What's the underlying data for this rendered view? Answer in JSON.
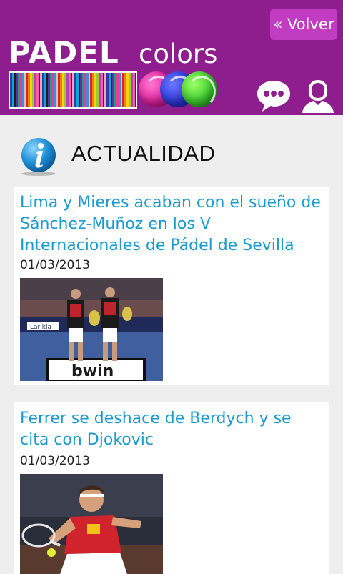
{
  "header": {
    "back_label": "« Volver",
    "logo_main": "PADEL",
    "logo_sub": "colors",
    "bg_color": "#8e1e8e",
    "button_color": "#c13cc0"
  },
  "section": {
    "title": "ACTUALIDAD",
    "icon": "info-icon"
  },
  "articles": [
    {
      "title": "Lima y Mieres acaban con el sueño de Sánchez-Muñoz en los V Internacionales de Pádel de Sevilla",
      "date": "01/03/2013",
      "banner_text": "bwin",
      "sponsor_text": "Larikia"
    },
    {
      "title": "Ferrer se deshace de Berdych y se cita con Djokovic",
      "date": "01/03/2013"
    }
  ],
  "colors": {
    "link": "#1a9bd0",
    "page_bg": "#eeeeee"
  }
}
